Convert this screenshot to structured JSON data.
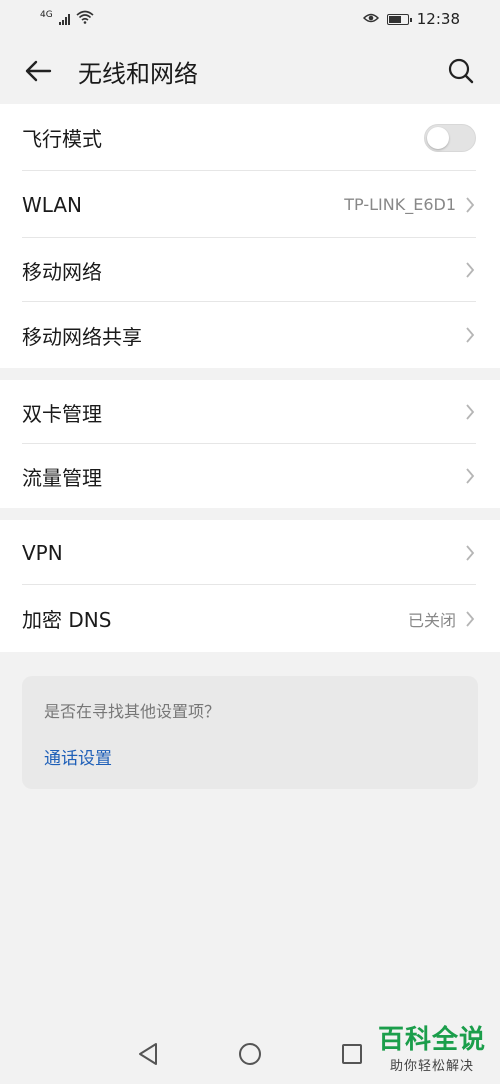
{
  "status_bar": {
    "network": "4G",
    "time": "12:38",
    "icons": [
      "signal-icon",
      "wifi-icon",
      "eye-comfort-icon",
      "battery-icon"
    ]
  },
  "app_bar": {
    "title": "无线和网络",
    "icons": [
      "back-arrow-icon",
      "search-icon"
    ]
  },
  "groups": [
    {
      "items": [
        {
          "label": "飞行模式",
          "control": "toggle",
          "toggle_on": false
        },
        {
          "label": "WLAN",
          "value": "TP-LINK_E6D1"
        },
        {
          "label": "移动网络"
        },
        {
          "label": "移动网络共享"
        }
      ]
    },
    {
      "items": [
        {
          "label": "双卡管理"
        },
        {
          "label": "流量管理"
        }
      ]
    },
    {
      "items": [
        {
          "label": "VPN"
        },
        {
          "label": "加密 DNS",
          "value": "已关闭"
        }
      ]
    }
  ],
  "suggestion": {
    "question": "是否在寻找其他设置项？",
    "link": "通话设置"
  },
  "nav_bar": {
    "icons": [
      "back-triangle-icon",
      "home-circle-icon",
      "recents-square-icon"
    ]
  },
  "watermark": {
    "title": "百科全说",
    "subtitle": "助你轻松解决"
  },
  "colors": {
    "background": "#f2f2f2",
    "card": "#ffffff",
    "link": "#1e5fb8",
    "watermark": "#1b9e4b"
  }
}
